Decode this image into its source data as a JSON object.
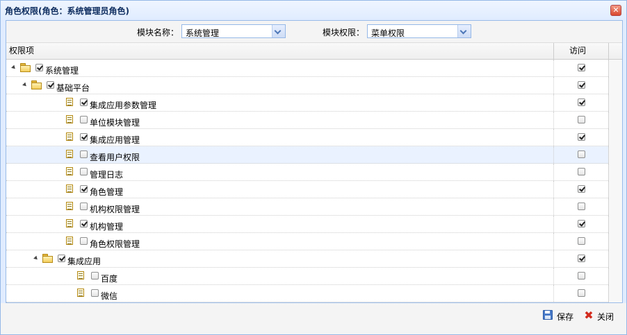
{
  "window": {
    "title": "角色权限(角色：系统管理员角色)",
    "close_icon": "✕"
  },
  "toolbar": {
    "module_label": "模块名称：",
    "module_value": "系统管理",
    "perm_label": "模块权限：",
    "perm_value": "菜单权限"
  },
  "grid": {
    "col_item": "权限项",
    "col_access": "访问",
    "rows": [
      {
        "label": "系统管理",
        "level": 0,
        "type": "folder",
        "expanded": true,
        "checked": true,
        "access": true
      },
      {
        "label": "基础平台",
        "level": 1,
        "type": "folder",
        "expanded": true,
        "checked": true,
        "access": true
      },
      {
        "label": "集成应用参数管理",
        "level": 2,
        "type": "file",
        "checked": true,
        "access": true
      },
      {
        "label": "单位模块管理",
        "level": 2,
        "type": "file",
        "checked": false,
        "access": false
      },
      {
        "label": "集成应用管理",
        "level": 2,
        "type": "file",
        "checked": true,
        "access": true
      },
      {
        "label": "查看用户权限",
        "level": 2,
        "type": "file",
        "checked": false,
        "access": false,
        "highlighted": true
      },
      {
        "label": "管理日志",
        "level": 2,
        "type": "file",
        "checked": false,
        "access": false
      },
      {
        "label": "角色管理",
        "level": 2,
        "type": "file",
        "checked": true,
        "access": true
      },
      {
        "label": "机构权限管理",
        "level": 2,
        "type": "file",
        "checked": false,
        "access": false
      },
      {
        "label": "机构管理",
        "level": 2,
        "type": "file",
        "checked": true,
        "access": true
      },
      {
        "label": "角色权限管理",
        "level": 2,
        "type": "file",
        "checked": false,
        "access": false
      },
      {
        "label": "集成应用",
        "level": 2,
        "type": "folder",
        "expanded": true,
        "checked": true,
        "access": true
      },
      {
        "label": "百度",
        "level": 3,
        "type": "file",
        "checked": false,
        "access": false
      },
      {
        "label": "微信",
        "level": 3,
        "type": "file",
        "checked": false,
        "access": false
      }
    ]
  },
  "footer": {
    "save_label": "保存",
    "close_label": "关闭"
  },
  "colors": {
    "border": "#95B8E7",
    "header_bg": "#E0ECFF",
    "highlight_row": "#EAF2FF"
  }
}
